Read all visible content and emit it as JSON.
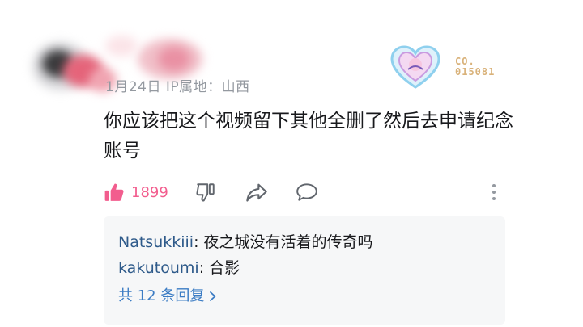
{
  "comment": {
    "meta": "1月24日 IP属地：山西",
    "content": "你应该把这个视频留下其他全删了然后去申请纪念账号",
    "like_count": "1899"
  },
  "badge": {
    "code_line1": "CO.",
    "code_line2": "015081"
  },
  "replies": {
    "items": [
      {
        "user": "Natsukkiii",
        "separator": ": ",
        "text": "夜之城没有活着的传奇吗"
      },
      {
        "user": "kakutoumi",
        "separator": ": ",
        "text": "合影"
      }
    ],
    "more_label": "共 12 条回复"
  },
  "colors": {
    "like": "#f25d8e",
    "link": "#3b7cc4",
    "meta": "#9499a0"
  }
}
